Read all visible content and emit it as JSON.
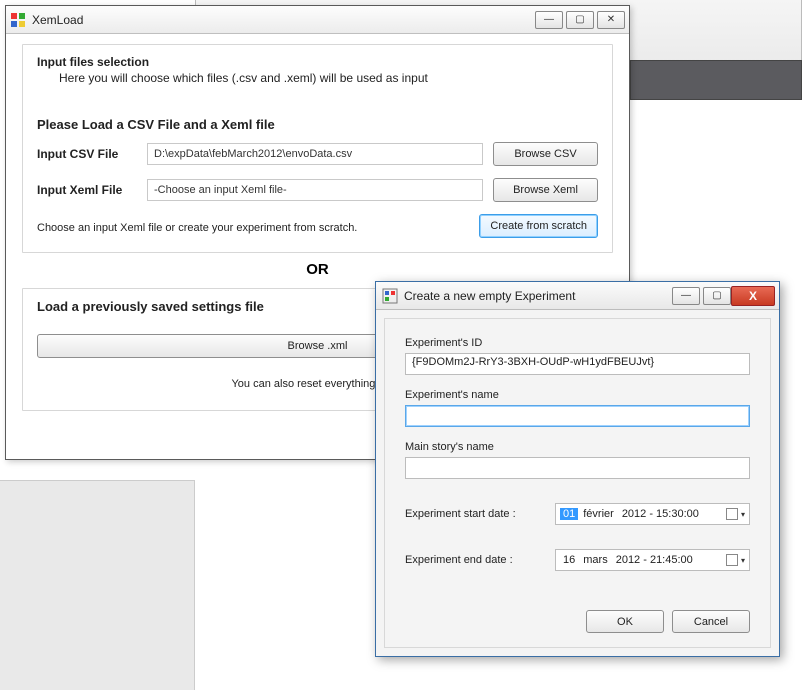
{
  "win1": {
    "title": "XemLoad",
    "sectionTitle": "Input files selection",
    "sectionSub": "Here you will choose which files (.csv and .xeml) will be used as input",
    "loadHeading": "Please Load a CSV File and a Xeml file",
    "csvLabel": "Input CSV File",
    "csvValue": "D:\\expData\\febMarch2012\\envoData.csv",
    "csvBrowse": "Browse CSV",
    "xemlLabel": "Input Xeml File",
    "xemlValue": "-Choose an input Xeml file-",
    "xemlBrowse": "Browse Xeml",
    "hint": "Choose an input Xeml file or create your experiment from scratch.",
    "createScratch": "Create from scratch",
    "or": "OR",
    "loadSaved": "Load a previously saved settings file",
    "browseXml": "Browse .xml",
    "footer": "You can also reset everything by cli"
  },
  "win2": {
    "title": "Create a new empty Experiment",
    "idLabel": "Experiment's ID",
    "idValue": "{F9DOMm2J-RrY3-3BXH-OUdP-wH1ydFBEUJvt}",
    "nameLabel": "Experiment's name",
    "nameValue": "",
    "storyLabel": "Main story's name",
    "storyValue": "",
    "startLabel": "Experiment start date :",
    "start": {
      "day": "01",
      "month": "février",
      "rest": "2012 - 15:30:00"
    },
    "endLabel": "Experiment end date :",
    "end": {
      "day": "16",
      "month": "mars",
      "rest": "2012 - 21:45:00"
    },
    "ok": "OK",
    "cancel": "Cancel"
  }
}
